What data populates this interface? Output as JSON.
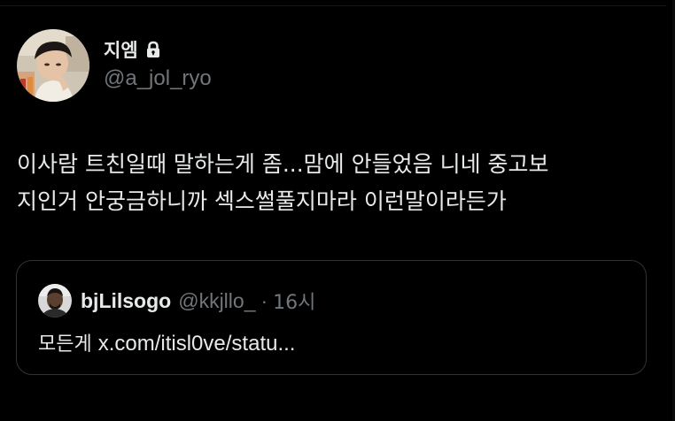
{
  "tweet": {
    "author": {
      "display_name": "지엠",
      "handle": "@a_jol_ryo",
      "protected_icon": "lock-icon"
    },
    "text_lines": [
      "이사람 트친일때 말하는게 좀...맘에 안들었음 니네 중고보",
      "지인거 안궁금하니까 섹스썰풀지마라 이런말이라든가"
    ]
  },
  "quoted_tweet": {
    "author": {
      "display_name": "bjLilsogo",
      "handle": "@kkjllo_",
      "separator": "·",
      "time": "16시"
    },
    "text_prefix": "모든게 ",
    "text_link": "x.com/itisl0ve/statu..."
  },
  "colors": {
    "background": "#000000",
    "primary_text": "#e7e9ea",
    "secondary_text": "#71767b",
    "border": "#2f3336"
  }
}
